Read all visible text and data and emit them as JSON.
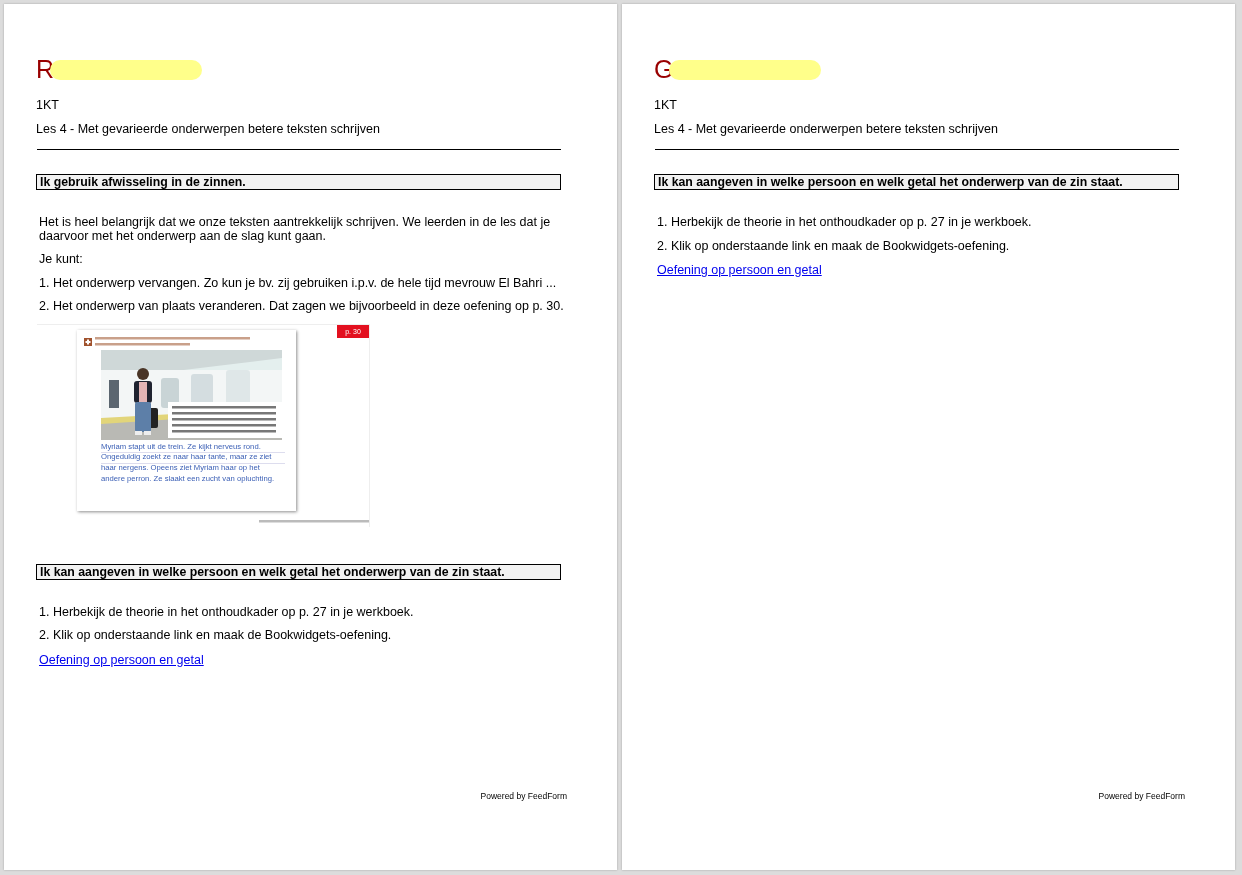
{
  "pages": [
    {
      "name": {
        "text": "R",
        "redacted": true
      },
      "class_code": "1KT",
      "lesson": "Les 4 - Met gevarieerde onderwerpen betere teksten schrijven",
      "sections": [
        {
          "heading": "Ik gebruik afwisseling in de zinnen.",
          "blocks": [
            {
              "kind": "paragraph",
              "text": "Het is heel belangrijk dat we onze teksten aantrekkelijk schrijven. We leerden in de les dat je daarvoor met het onderwerp aan de slag kunt gaan."
            },
            {
              "kind": "paragraph",
              "text": "Je kunt:"
            },
            {
              "kind": "paragraph",
              "text": "1. Het onderwerp vervangen. Zo kun je bv. zij gebruiken i.p.v. de hele tijd mevrouw El Bahri ..."
            },
            {
              "kind": "paragraph",
              "text": "2. Het onderwerp van plaats veranderen. Dat zagen we bijvoorbeeld in deze oefening op p. 30."
            },
            {
              "kind": "figure",
              "page_badge": "p. 30",
              "answer": "Myriam stapt uit de trein. Ze kijkt nerveus rond. Ongeduldig zoekt ze naar haar tante, maar ze ziet haar nergens. Opeens ziet Myriam haar op het andere perron. Ze slaakt een zucht van opluchting."
            }
          ]
        },
        {
          "heading": "Ik kan aangeven in welke persoon en welk getal het onderwerp van de zin staat.",
          "blocks": [
            {
              "kind": "paragraph",
              "text": "1. Herbekijk de theorie in het onthoudkader op p. 27 in je werkboek."
            },
            {
              "kind": "paragraph",
              "text": "2. Klik op onderstaande link en maak de Bookwidgets-oefening."
            },
            {
              "kind": "link",
              "text": "Oefening op persoon en getal"
            }
          ]
        }
      ],
      "footer": "Powered by FeedForm"
    },
    {
      "name": {
        "text": "G",
        "redacted": true
      },
      "class_code": "1KT",
      "lesson": "Les 4 - Met gevarieerde onderwerpen betere teksten schrijven",
      "sections": [
        {
          "heading": "Ik kan aangeven in welke persoon en welk getal het onderwerp van de zin staat.",
          "blocks": [
            {
              "kind": "paragraph",
              "text": "1. Herbekijk de theorie in het onthoudkader op p. 27 in je werkboek."
            },
            {
              "kind": "paragraph",
              "text": "2. Klik op onderstaande link en maak de Bookwidgets-oefening."
            },
            {
              "kind": "link",
              "text": "Oefening op persoon en getal"
            }
          ]
        }
      ],
      "footer": "Powered by FeedForm"
    }
  ]
}
